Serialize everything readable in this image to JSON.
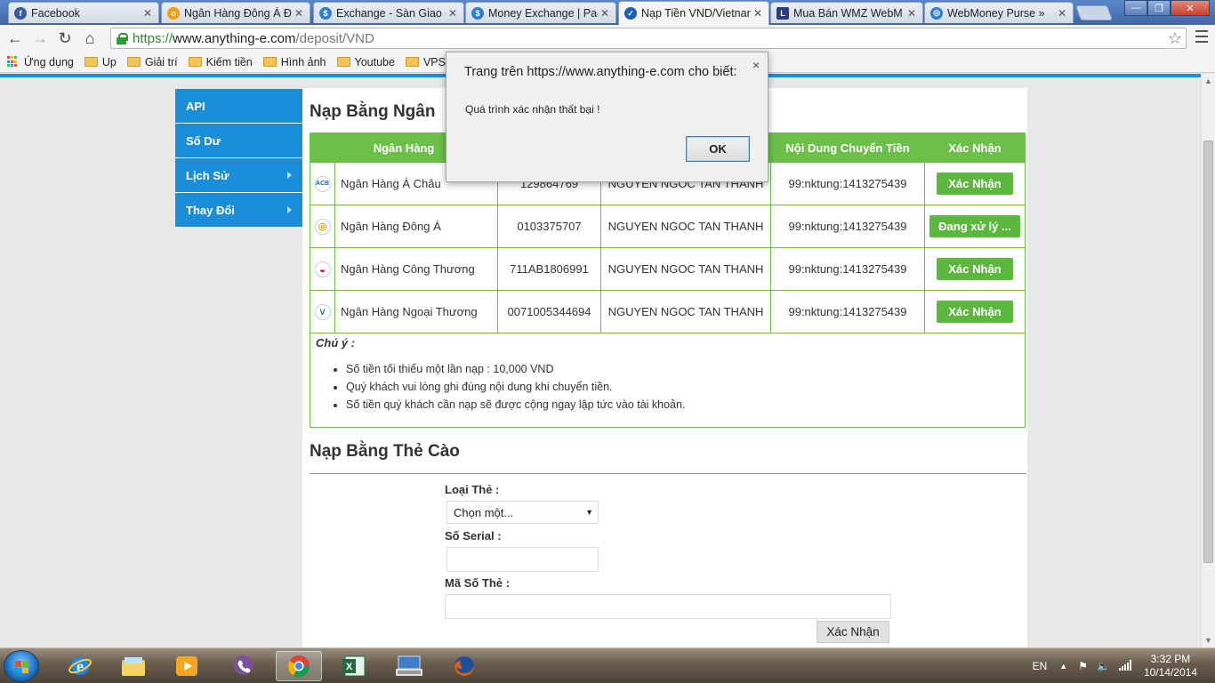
{
  "browser": {
    "tabs": [
      {
        "label": "Facebook",
        "color": "#3b5998",
        "glyph": "f"
      },
      {
        "label": "Ngân Hàng Đông Á Đi",
        "color": "#f39c12",
        "glyph": "o"
      },
      {
        "label": "Exchange - Sàn Giao d",
        "color": "#2f80c8",
        "glyph": "$"
      },
      {
        "label": "Money Exchange | Pag",
        "color": "#2f80c8",
        "glyph": "$"
      },
      {
        "label": "Nạp Tiền VND/Vietnar",
        "color": "#1a5fb4",
        "glyph": "✓"
      },
      {
        "label": "Mua Bán WMZ WebM",
        "color": "#2c3e7b",
        "glyph": "L"
      },
      {
        "label": "WebMoney Purse »",
        "color": "#2d7dd2",
        "glyph": "◎"
      }
    ],
    "url_https": "https://",
    "url_host": "www.anything-e.com",
    "url_path": "/deposit/VND",
    "bookmarks": [
      "Ứng dụng",
      "Up",
      "Giải trí",
      "Kiếm tiền",
      "Hình ảnh",
      "Youtube",
      "VPS"
    ]
  },
  "dialog": {
    "title": "Trang trên https://www.anything-e.com cho biết:",
    "message": "Quá trình xác nhận thất bại !",
    "ok": "OK",
    "close": "×"
  },
  "sidebar": {
    "items": [
      {
        "label": "API",
        "submenu": false
      },
      {
        "label": "Số Dư",
        "submenu": false
      },
      {
        "label": "Lịch Sử",
        "submenu": true
      },
      {
        "label": "Thay Đổi",
        "submenu": true
      }
    ]
  },
  "bank_section": {
    "title": "Nạp Bằng Ngân",
    "headers": [
      "Ngân Hàng",
      "",
      "",
      "Nội Dung Chuyển Tiền",
      "Xác Nhận"
    ],
    "rows": [
      {
        "logo": "acb-icon",
        "logo_text": "ACB",
        "logo_color": "#1f5fbf",
        "name": "Ngân Hàng Á Châu",
        "account": "129864769",
        "owner": "NGUYEN NGOC TAN THANH",
        "content": "99:nktung:1413275439",
        "action": "Xác Nhận"
      },
      {
        "logo": "donga-icon",
        "logo_text": "◎",
        "logo_color": "#f39c12",
        "name": "Ngân Hàng Đông Á",
        "account": "0103375707",
        "owner": "NGUYEN NGOC TAN THANH",
        "content": "99:nktung:1413275439",
        "action": "Đang xử lý ..."
      },
      {
        "logo": "vietinbank-icon",
        "logo_text": "◒",
        "logo_color": "#c8102e",
        "name": "Ngân Hàng Công Thương",
        "account": "711AB1806991",
        "owner": "NGUYEN NGOC TAN THANH",
        "content": "99:nktung:1413275439",
        "action": "Xác Nhận"
      },
      {
        "logo": "vietcombank-icon",
        "logo_text": "V",
        "logo_color": "#0b7a3b",
        "name": "Ngân Hàng Ngoại Thương",
        "account": "0071005344694",
        "owner": "NGUYEN NGOC TAN THANH",
        "content": "99:nktung:1413275439",
        "action": "Xác Nhận"
      }
    ],
    "note_title": "Chú ý :",
    "notes": [
      "Số tiền tối thiểu một lần nạp : 10,000 VND",
      "Quý khách vui lòng ghi đúng nội dung khi chuyển tiền.",
      "Số tiền quý khách cần nạp sẽ được cộng ngay lập tức vào tài khoản."
    ]
  },
  "card_section": {
    "title": "Nạp Bằng Thẻ Cào",
    "card_type_label": "Loại Thẻ :",
    "card_type_value": "Chọn một...",
    "serial_label": "Số Serial :",
    "serial_value": "",
    "pin_label": "Mã Số Thẻ :",
    "pin_value": "",
    "submit": "Xác Nhận"
  },
  "taskbar": {
    "lang": "EN",
    "time": "3:32 PM",
    "date": "10/14/2014"
  },
  "colors": {
    "accent_blue": "#1a8ed8",
    "accent_green": "#6cc04a",
    "button_green": "#5cb73e"
  }
}
